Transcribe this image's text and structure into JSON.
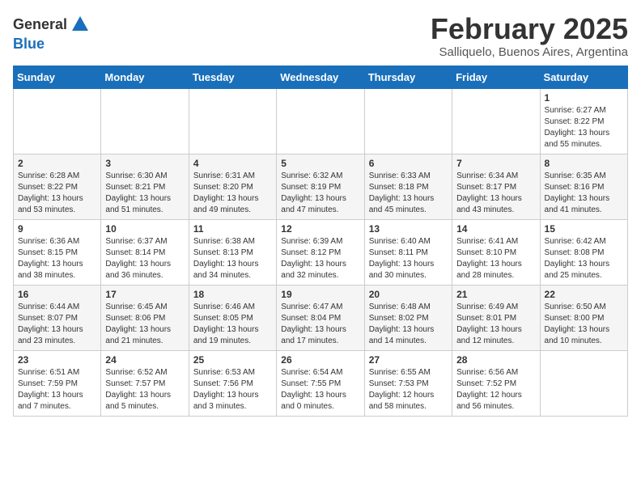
{
  "header": {
    "logo_general": "General",
    "logo_blue": "Blue",
    "month_title": "February 2025",
    "location": "Salliquelo, Buenos Aires, Argentina"
  },
  "days_of_week": [
    "Sunday",
    "Monday",
    "Tuesday",
    "Wednesday",
    "Thursday",
    "Friday",
    "Saturday"
  ],
  "weeks": [
    {
      "days": [
        {
          "num": "",
          "info": ""
        },
        {
          "num": "",
          "info": ""
        },
        {
          "num": "",
          "info": ""
        },
        {
          "num": "",
          "info": ""
        },
        {
          "num": "",
          "info": ""
        },
        {
          "num": "",
          "info": ""
        },
        {
          "num": "1",
          "info": "Sunrise: 6:27 AM\nSunset: 8:22 PM\nDaylight: 13 hours\nand 55 minutes."
        }
      ]
    },
    {
      "days": [
        {
          "num": "2",
          "info": "Sunrise: 6:28 AM\nSunset: 8:22 PM\nDaylight: 13 hours\nand 53 minutes."
        },
        {
          "num": "3",
          "info": "Sunrise: 6:30 AM\nSunset: 8:21 PM\nDaylight: 13 hours\nand 51 minutes."
        },
        {
          "num": "4",
          "info": "Sunrise: 6:31 AM\nSunset: 8:20 PM\nDaylight: 13 hours\nand 49 minutes."
        },
        {
          "num": "5",
          "info": "Sunrise: 6:32 AM\nSunset: 8:19 PM\nDaylight: 13 hours\nand 47 minutes."
        },
        {
          "num": "6",
          "info": "Sunrise: 6:33 AM\nSunset: 8:18 PM\nDaylight: 13 hours\nand 45 minutes."
        },
        {
          "num": "7",
          "info": "Sunrise: 6:34 AM\nSunset: 8:17 PM\nDaylight: 13 hours\nand 43 minutes."
        },
        {
          "num": "8",
          "info": "Sunrise: 6:35 AM\nSunset: 8:16 PM\nDaylight: 13 hours\nand 41 minutes."
        }
      ]
    },
    {
      "days": [
        {
          "num": "9",
          "info": "Sunrise: 6:36 AM\nSunset: 8:15 PM\nDaylight: 13 hours\nand 38 minutes."
        },
        {
          "num": "10",
          "info": "Sunrise: 6:37 AM\nSunset: 8:14 PM\nDaylight: 13 hours\nand 36 minutes."
        },
        {
          "num": "11",
          "info": "Sunrise: 6:38 AM\nSunset: 8:13 PM\nDaylight: 13 hours\nand 34 minutes."
        },
        {
          "num": "12",
          "info": "Sunrise: 6:39 AM\nSunset: 8:12 PM\nDaylight: 13 hours\nand 32 minutes."
        },
        {
          "num": "13",
          "info": "Sunrise: 6:40 AM\nSunset: 8:11 PM\nDaylight: 13 hours\nand 30 minutes."
        },
        {
          "num": "14",
          "info": "Sunrise: 6:41 AM\nSunset: 8:10 PM\nDaylight: 13 hours\nand 28 minutes."
        },
        {
          "num": "15",
          "info": "Sunrise: 6:42 AM\nSunset: 8:08 PM\nDaylight: 13 hours\nand 25 minutes."
        }
      ]
    },
    {
      "days": [
        {
          "num": "16",
          "info": "Sunrise: 6:44 AM\nSunset: 8:07 PM\nDaylight: 13 hours\nand 23 minutes."
        },
        {
          "num": "17",
          "info": "Sunrise: 6:45 AM\nSunset: 8:06 PM\nDaylight: 13 hours\nand 21 minutes."
        },
        {
          "num": "18",
          "info": "Sunrise: 6:46 AM\nSunset: 8:05 PM\nDaylight: 13 hours\nand 19 minutes."
        },
        {
          "num": "19",
          "info": "Sunrise: 6:47 AM\nSunset: 8:04 PM\nDaylight: 13 hours\nand 17 minutes."
        },
        {
          "num": "20",
          "info": "Sunrise: 6:48 AM\nSunset: 8:02 PM\nDaylight: 13 hours\nand 14 minutes."
        },
        {
          "num": "21",
          "info": "Sunrise: 6:49 AM\nSunset: 8:01 PM\nDaylight: 13 hours\nand 12 minutes."
        },
        {
          "num": "22",
          "info": "Sunrise: 6:50 AM\nSunset: 8:00 PM\nDaylight: 13 hours\nand 10 minutes."
        }
      ]
    },
    {
      "days": [
        {
          "num": "23",
          "info": "Sunrise: 6:51 AM\nSunset: 7:59 PM\nDaylight: 13 hours\nand 7 minutes."
        },
        {
          "num": "24",
          "info": "Sunrise: 6:52 AM\nSunset: 7:57 PM\nDaylight: 13 hours\nand 5 minutes."
        },
        {
          "num": "25",
          "info": "Sunrise: 6:53 AM\nSunset: 7:56 PM\nDaylight: 13 hours\nand 3 minutes."
        },
        {
          "num": "26",
          "info": "Sunrise: 6:54 AM\nSunset: 7:55 PM\nDaylight: 13 hours\nand 0 minutes."
        },
        {
          "num": "27",
          "info": "Sunrise: 6:55 AM\nSunset: 7:53 PM\nDaylight: 12 hours\nand 58 minutes."
        },
        {
          "num": "28",
          "info": "Sunrise: 6:56 AM\nSunset: 7:52 PM\nDaylight: 12 hours\nand 56 minutes."
        },
        {
          "num": "",
          "info": ""
        }
      ]
    }
  ]
}
